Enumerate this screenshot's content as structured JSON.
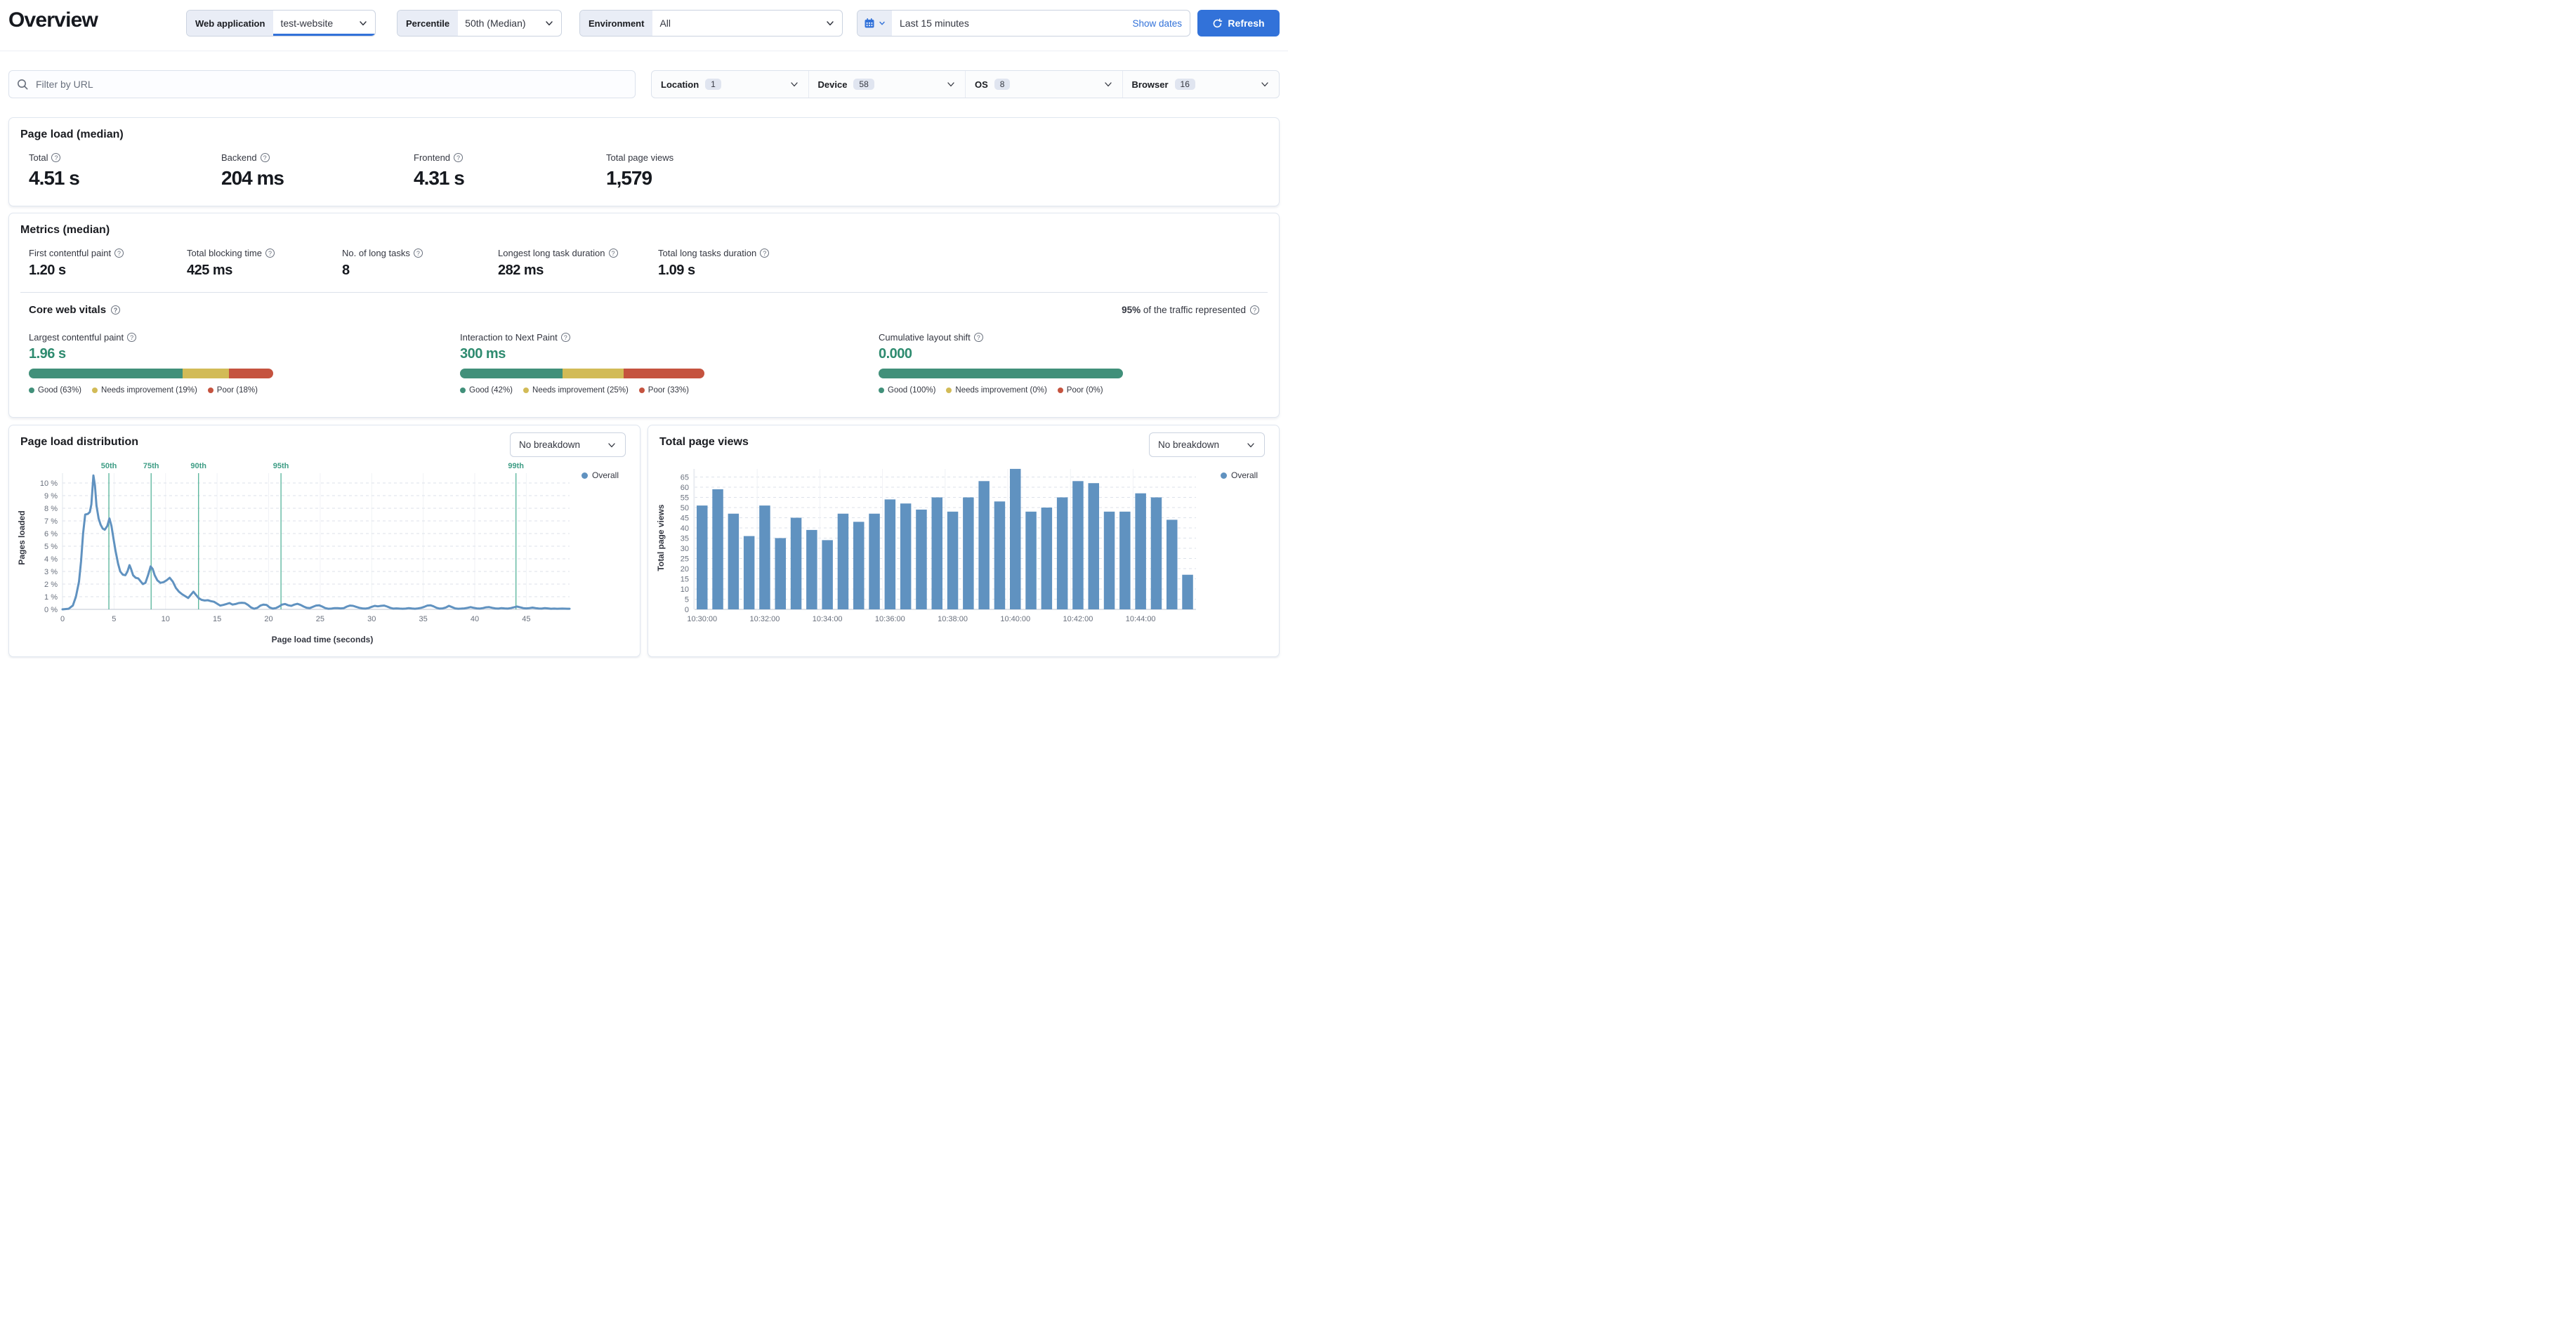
{
  "header": {
    "title": "Overview",
    "app_selector": {
      "label": "Web application",
      "value": "test-website"
    },
    "percentile": {
      "label": "Percentile",
      "value": "50th (Median)"
    },
    "environment": {
      "label": "Environment",
      "value": "All"
    },
    "datepicker": {
      "value": "Last 15 minutes",
      "show_dates": "Show dates"
    },
    "refresh_label": "Refresh"
  },
  "icons": {
    "search": "magnifier",
    "calendar": "calendar",
    "refresh": "circular-arrow",
    "chevron": "chevron-down",
    "help": "question-in-circle"
  },
  "filters": {
    "search_placeholder": "Filter by URL",
    "groups": [
      {
        "label": "Location",
        "count": "1"
      },
      {
        "label": "Device",
        "count": "58"
      },
      {
        "label": "OS",
        "count": "8"
      },
      {
        "label": "Browser",
        "count": "16"
      }
    ]
  },
  "page_load": {
    "title": "Page load (median)",
    "stats": [
      {
        "label": "Total",
        "value": "4.51 s"
      },
      {
        "label": "Backend",
        "value": "204 ms"
      },
      {
        "label": "Frontend",
        "value": "4.31 s"
      },
      {
        "label": "Total page views",
        "value": "1,579"
      }
    ]
  },
  "metrics": {
    "title": "Metrics (median)",
    "stats": [
      {
        "label": "First contentful paint",
        "value": "1.20 s"
      },
      {
        "label": "Total blocking time",
        "value": "425 ms"
      },
      {
        "label": "No. of long tasks",
        "value": "8"
      },
      {
        "label": "Longest long task duration",
        "value": "282 ms"
      },
      {
        "label": "Total long tasks duration",
        "value": "1.09 s"
      }
    ]
  },
  "core_web_vitals": {
    "title": "Core web vitals",
    "traffic_note_strong": "95%",
    "traffic_note_rest": " of the traffic represented",
    "items": [
      {
        "label": "Largest contentful paint",
        "value": "1.96 s",
        "segments": [
          63,
          19,
          18
        ],
        "legend": [
          "Good (63%)",
          "Needs improvement (19%)",
          "Poor (18%)"
        ]
      },
      {
        "label": "Interaction to Next Paint",
        "value": "300 ms",
        "segments": [
          42,
          25,
          33
        ],
        "legend": [
          "Good (42%)",
          "Needs improvement (25%)",
          "Poor (33%)"
        ]
      },
      {
        "label": "Cumulative layout shift",
        "value": "0.000",
        "segments": [
          100,
          0,
          0
        ],
        "legend": [
          "Good (100%)",
          "Needs improvement (0%)",
          "Poor (0%)"
        ]
      }
    ]
  },
  "colors": {
    "accent": "#3272D9",
    "series": "#6092C0",
    "percentile_line": "#54B399",
    "percentile_label": "#3E9D85",
    "vitals_value": "#2E8B6F",
    "good": "#41907A",
    "needs_improvement": "#D2BB57",
    "poor": "#C5533F"
  },
  "chart_data": [
    {
      "type": "line",
      "title": "Page load distribution",
      "breakdown_selector": "No breakdown",
      "legend": [
        "Overall"
      ],
      "xlabel": "Page load time (seconds)",
      "ylabel": "Pages loaded",
      "x_ticks": [
        0,
        5,
        10,
        15,
        20,
        25,
        30,
        35,
        40,
        45
      ],
      "y_ticks": [
        "0 %",
        "1 %",
        "2 %",
        "3 %",
        "4 %",
        "5 %",
        "6 %",
        "7 %",
        "8 %",
        "9 %",
        "10 %"
      ],
      "xlim": [
        0,
        49.2
      ],
      "ylim": [
        0,
        10.8
      ],
      "grid": true,
      "legend_position": "top-right",
      "percentiles": [
        {
          "label": "50th",
          "seconds": 4.5
        },
        {
          "label": "75th",
          "seconds": 8.6
        },
        {
          "label": "90th",
          "seconds": 13.2
        },
        {
          "label": "95th",
          "seconds": 21.2
        },
        {
          "label": "99th",
          "seconds": 44.0
        }
      ],
      "series": [
        {
          "name": "Overall",
          "points": [
            [
              0,
              0
            ],
            [
              0.6,
              0.05
            ],
            [
              1.0,
              0.3
            ],
            [
              1.3,
              1.0
            ],
            [
              1.6,
              2.2
            ],
            [
              1.8,
              3.8
            ],
            [
              2.0,
              6.0
            ],
            [
              2.2,
              7.5
            ],
            [
              2.45,
              7.55
            ],
            [
              2.65,
              7.7
            ],
            [
              2.8,
              8.3
            ],
            [
              3.0,
              10.6
            ],
            [
              3.15,
              9.8
            ],
            [
              3.3,
              8.2
            ],
            [
              3.5,
              7.2
            ],
            [
              3.7,
              6.7
            ],
            [
              3.9,
              6.4
            ],
            [
              4.1,
              6.3
            ],
            [
              4.35,
              6.6
            ],
            [
              4.55,
              7.2
            ],
            [
              4.75,
              6.6
            ],
            [
              4.95,
              5.6
            ],
            [
              5.15,
              4.6
            ],
            [
              5.4,
              3.6
            ],
            [
              5.6,
              3.0
            ],
            [
              5.85,
              2.75
            ],
            [
              6.1,
              2.7
            ],
            [
              6.3,
              3.0
            ],
            [
              6.5,
              3.5
            ],
            [
              6.65,
              3.2
            ],
            [
              6.85,
              2.7
            ],
            [
              7.1,
              2.5
            ],
            [
              7.35,
              2.45
            ],
            [
              7.6,
              2.2
            ],
            [
              7.8,
              2.0
            ],
            [
              8.05,
              2.1
            ],
            [
              8.3,
              2.7
            ],
            [
              8.55,
              3.4
            ],
            [
              8.75,
              3.2
            ],
            [
              8.95,
              2.7
            ],
            [
              9.2,
              2.3
            ],
            [
              9.5,
              2.1
            ],
            [
              9.8,
              2.15
            ],
            [
              10.1,
              2.3
            ],
            [
              10.4,
              2.5
            ],
            [
              10.7,
              2.2
            ],
            [
              11.0,
              1.7
            ],
            [
              11.3,
              1.4
            ],
            [
              11.6,
              1.2
            ],
            [
              11.9,
              1.05
            ],
            [
              12.2,
              0.9
            ],
            [
              12.5,
              1.2
            ],
            [
              12.7,
              1.4
            ],
            [
              12.9,
              1.2
            ],
            [
              13.2,
              0.9
            ],
            [
              13.5,
              0.75
            ],
            [
              13.8,
              0.7
            ],
            [
              14.1,
              0.72
            ],
            [
              14.4,
              0.65
            ],
            [
              14.7,
              0.6
            ],
            [
              15.0,
              0.45
            ],
            [
              15.3,
              0.3
            ],
            [
              15.6,
              0.35
            ],
            [
              15.9,
              0.42
            ],
            [
              16.2,
              0.5
            ],
            [
              16.5,
              0.38
            ],
            [
              16.8,
              0.42
            ],
            [
              17.1,
              0.5
            ],
            [
              17.4,
              0.52
            ],
            [
              17.7,
              0.5
            ],
            [
              18.0,
              0.35
            ],
            [
              18.3,
              0.15
            ],
            [
              18.6,
              0.05
            ],
            [
              18.9,
              0.12
            ],
            [
              19.2,
              0.3
            ],
            [
              19.5,
              0.38
            ],
            [
              19.8,
              0.35
            ],
            [
              20.1,
              0.15
            ],
            [
              20.4,
              0.06
            ],
            [
              20.7,
              0.1
            ],
            [
              21.0,
              0.22
            ],
            [
              21.3,
              0.38
            ],
            [
              21.6,
              0.42
            ],
            [
              21.9,
              0.32
            ],
            [
              22.2,
              0.28
            ],
            [
              22.5,
              0.38
            ],
            [
              22.8,
              0.44
            ],
            [
              23.1,
              0.35
            ],
            [
              23.4,
              0.22
            ],
            [
              23.7,
              0.12
            ],
            [
              24.0,
              0.1
            ],
            [
              24.3,
              0.2
            ],
            [
              24.6,
              0.3
            ],
            [
              24.9,
              0.32
            ],
            [
              25.2,
              0.22
            ],
            [
              25.5,
              0.1
            ],
            [
              25.8,
              0.05
            ],
            [
              26.1,
              0.06
            ],
            [
              26.4,
              0.1
            ],
            [
              26.7,
              0.1
            ],
            [
              27.0,
              0.08
            ],
            [
              27.3,
              0.1
            ],
            [
              27.6,
              0.22
            ],
            [
              27.9,
              0.3
            ],
            [
              28.2,
              0.28
            ],
            [
              28.5,
              0.2
            ],
            [
              28.8,
              0.12
            ],
            [
              29.1,
              0.08
            ],
            [
              29.4,
              0.06
            ],
            [
              29.7,
              0.1
            ],
            [
              30.0,
              0.2
            ],
            [
              30.3,
              0.28
            ],
            [
              30.6,
              0.24
            ],
            [
              30.9,
              0.28
            ],
            [
              31.2,
              0.3
            ],
            [
              31.5,
              0.22
            ],
            [
              31.8,
              0.12
            ],
            [
              32.1,
              0.06
            ],
            [
              32.4,
              0.08
            ],
            [
              32.7,
              0.06
            ],
            [
              33.0,
              0.05
            ],
            [
              33.3,
              0.06
            ],
            [
              33.6,
              0.1
            ],
            [
              33.9,
              0.07
            ],
            [
              34.2,
              0.05
            ],
            [
              34.5,
              0.08
            ],
            [
              34.8,
              0.12
            ],
            [
              35.1,
              0.2
            ],
            [
              35.4,
              0.3
            ],
            [
              35.7,
              0.32
            ],
            [
              36.0,
              0.24
            ],
            [
              36.3,
              0.12
            ],
            [
              36.6,
              0.06
            ],
            [
              36.9,
              0.08
            ],
            [
              37.2,
              0.15
            ],
            [
              37.5,
              0.28
            ],
            [
              37.8,
              0.18
            ],
            [
              38.1,
              0.08
            ],
            [
              38.4,
              0.05
            ],
            [
              38.7,
              0.06
            ],
            [
              39.0,
              0.08
            ],
            [
              39.3,
              0.12
            ],
            [
              39.6,
              0.18
            ],
            [
              39.9,
              0.12
            ],
            [
              40.2,
              0.08
            ],
            [
              40.5,
              0.06
            ],
            [
              40.8,
              0.1
            ],
            [
              41.1,
              0.16
            ],
            [
              41.4,
              0.18
            ],
            [
              41.7,
              0.12
            ],
            [
              42.0,
              0.08
            ],
            [
              42.3,
              0.06
            ],
            [
              42.6,
              0.1
            ],
            [
              42.9,
              0.08
            ],
            [
              43.2,
              0.06
            ],
            [
              43.5,
              0.1
            ],
            [
              43.8,
              0.16
            ],
            [
              44.1,
              0.22
            ],
            [
              44.4,
              0.16
            ],
            [
              44.7,
              0.1
            ],
            [
              45.0,
              0.08
            ],
            [
              45.3,
              0.1
            ],
            [
              45.6,
              0.14
            ],
            [
              45.9,
              0.1
            ],
            [
              46.2,
              0.07
            ],
            [
              46.5,
              0.06
            ],
            [
              46.8,
              0.1
            ],
            [
              47.1,
              0.08
            ],
            [
              47.4,
              0.05
            ],
            [
              47.7,
              0.06
            ],
            [
              48.0,
              0.05
            ],
            [
              48.5,
              0.06
            ],
            [
              49.0,
              0.05
            ],
            [
              49.2,
              0.05
            ]
          ]
        }
      ]
    },
    {
      "type": "bar",
      "title": "Total page views",
      "breakdown_selector": "No breakdown",
      "legend": [
        "Overall"
      ],
      "ylabel": "Total page views",
      "x_tick_labels": [
        "10:30:00",
        "10:32:00",
        "10:34:00",
        "10:36:00",
        "10:38:00",
        "10:40:00",
        "10:42:00",
        "10:44:00"
      ],
      "y_ticks": [
        0,
        5,
        10,
        15,
        20,
        25,
        30,
        35,
        40,
        45,
        50,
        55,
        60,
        65
      ],
      "grid": true,
      "legend_position": "top-right",
      "values": [
        51,
        59,
        47,
        36,
        51,
        35,
        45,
        39,
        34,
        47,
        43,
        47,
        54,
        52,
        49,
        55,
        48,
        55,
        63,
        53,
        69,
        48,
        50,
        55,
        63,
        62,
        48,
        48,
        57,
        55,
        44,
        17
      ]
    }
  ]
}
